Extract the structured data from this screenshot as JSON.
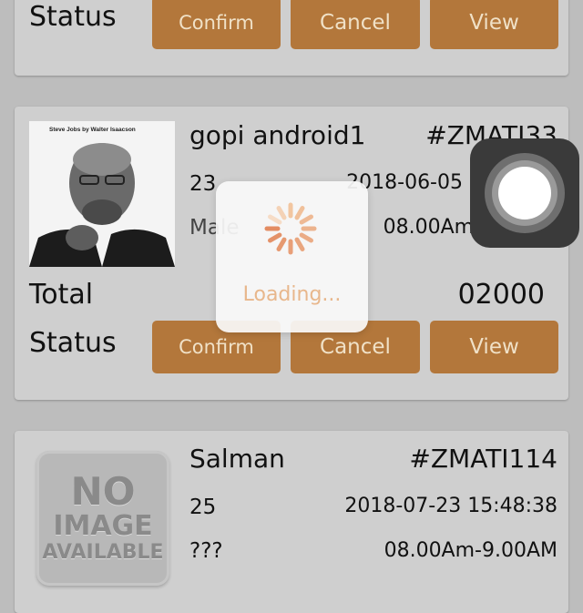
{
  "colors": {
    "accent_button": "#b3773b",
    "button_text": "#f0e1c7",
    "loading_text": "#e8b78c"
  },
  "card1": {
    "status_label": "Status",
    "buttons": {
      "confirm": "Confirm",
      "cancel": "Cancel",
      "view": "View"
    }
  },
  "card2": {
    "name": "gopi android1",
    "order_id": "#ZMATI33",
    "age": "23",
    "date": "2018-06-05",
    "gender": "Male",
    "slot": "08.00Am-",
    "total_label": "Total",
    "total_value": "02000",
    "status_label": "Status",
    "buttons": {
      "confirm": "Confirm",
      "cancel": "Cancel",
      "view": "View"
    },
    "photo_caption": "Steve Jobs by Walter Isaacson"
  },
  "card3": {
    "name": "Salman",
    "order_id": "#ZMATI114",
    "age": "25",
    "date": "2018-07-23 15:48:38",
    "gender": "???",
    "slot": "08.00Am-9.00AM",
    "no_image": {
      "line1": "NO",
      "line2": "IMAGE",
      "line3": "AVAILABLE"
    }
  },
  "loading": {
    "text": "Loading..."
  },
  "assistive_touch": {
    "icon": "assistive-touch-icon"
  }
}
